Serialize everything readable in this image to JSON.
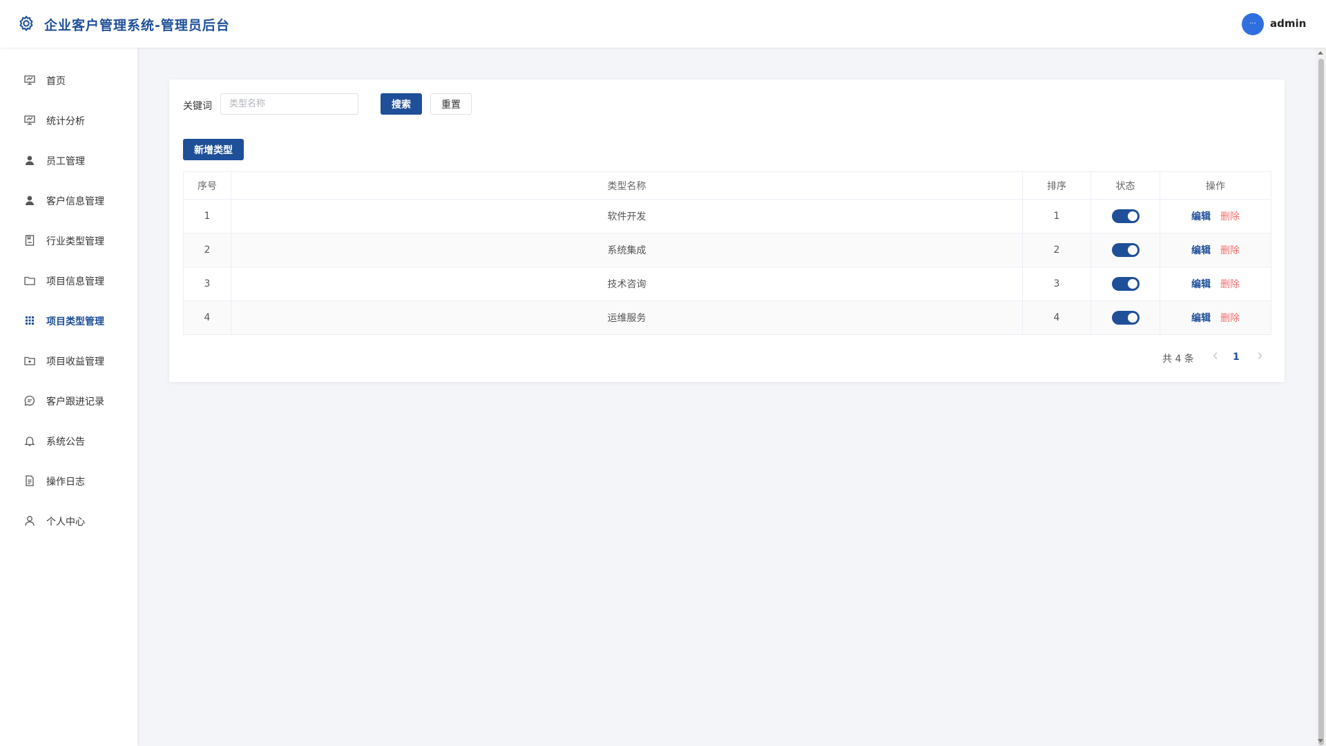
{
  "header": {
    "title": "企业客户管理系统-管理员后台",
    "avatar_text": "···",
    "username": "admin"
  },
  "sidebar": {
    "items": [
      {
        "label": "首页",
        "icon": "presentation-icon"
      },
      {
        "label": "统计分析",
        "icon": "presentation-icon"
      },
      {
        "label": "员工管理",
        "icon": "user-filled-icon"
      },
      {
        "label": "客户信息管理",
        "icon": "user-filled-icon"
      },
      {
        "label": "行业类型管理",
        "icon": "notebook-icon"
      },
      {
        "label": "项目信息管理",
        "icon": "folder-icon"
      },
      {
        "label": "项目类型管理",
        "icon": "grid-icon",
        "active": true
      },
      {
        "label": "项目收益管理",
        "icon": "folder-add-icon"
      },
      {
        "label": "客户跟进记录",
        "icon": "chat-icon"
      },
      {
        "label": "系统公告",
        "icon": "bell-icon"
      },
      {
        "label": "操作日志",
        "icon": "document-icon"
      },
      {
        "label": "个人中心",
        "icon": "user-outline-icon"
      }
    ]
  },
  "search": {
    "keyword_label": "关键词",
    "placeholder": "类型名称",
    "value": "",
    "search_button": "搜索",
    "reset_button": "重置"
  },
  "toolbar": {
    "add_button": "新增类型"
  },
  "table": {
    "columns": [
      "序号",
      "类型名称",
      "排序",
      "状态",
      "操作"
    ],
    "rows": [
      {
        "index": "1",
        "name": "软件开发",
        "sort": "1",
        "enabled": true
      },
      {
        "index": "2",
        "name": "系统集成",
        "sort": "2",
        "enabled": true
      },
      {
        "index": "3",
        "name": "技术咨询",
        "sort": "3",
        "enabled": true
      },
      {
        "index": "4",
        "name": "运维服务",
        "sort": "4",
        "enabled": true
      }
    ],
    "edit_label": "编辑",
    "delete_label": "删除"
  },
  "pagination": {
    "total_text": "共 4 条",
    "current_page": "1"
  },
  "colors": {
    "primary": "#1e4f98",
    "danger": "#f56c6c",
    "background": "#f3f5f9"
  }
}
